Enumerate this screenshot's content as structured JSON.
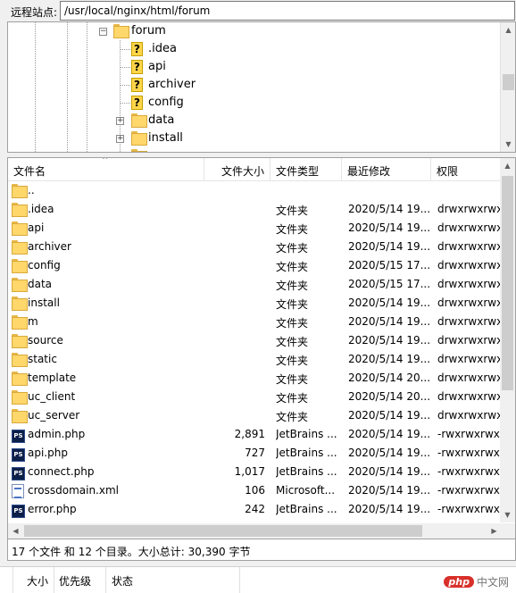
{
  "remote_site": {
    "label": "远程站点:",
    "path": "/usr/local/nginx/html/forum"
  },
  "tree": {
    "current": "forum",
    "children": [
      {
        "label": ".idea",
        "unknown": true
      },
      {
        "label": "api",
        "unknown": true
      },
      {
        "label": "archiver",
        "unknown": true
      },
      {
        "label": "config",
        "unknown": true
      },
      {
        "label": "data",
        "expandable": true
      },
      {
        "label": "install",
        "expandable": true
      }
    ]
  },
  "list": {
    "columns": [
      "文件名",
      "文件大小",
      "文件类型",
      "最近修改",
      "权限"
    ],
    "rows": [
      {
        "icon": "folder",
        "name": "..",
        "size": "",
        "type": "",
        "modified": "",
        "perms": ""
      },
      {
        "icon": "folder",
        "name": ".idea",
        "size": "",
        "type": "文件夹",
        "modified": "2020/5/14 19...",
        "perms": "drwxrwxrwx"
      },
      {
        "icon": "folder",
        "name": "api",
        "size": "",
        "type": "文件夹",
        "modified": "2020/5/14 19...",
        "perms": "drwxrwxrwx"
      },
      {
        "icon": "folder",
        "name": "archiver",
        "size": "",
        "type": "文件夹",
        "modified": "2020/5/14 19...",
        "perms": "drwxrwxrwx"
      },
      {
        "icon": "folder",
        "name": "config",
        "size": "",
        "type": "文件夹",
        "modified": "2020/5/15 17...",
        "perms": "drwxrwxrwx"
      },
      {
        "icon": "folder",
        "name": "data",
        "size": "",
        "type": "文件夹",
        "modified": "2020/5/15 17...",
        "perms": "drwxrwxrwx"
      },
      {
        "icon": "folder",
        "name": "install",
        "size": "",
        "type": "文件夹",
        "modified": "2020/5/14 19...",
        "perms": "drwxrwxrwx"
      },
      {
        "icon": "folder",
        "name": "m",
        "size": "",
        "type": "文件夹",
        "modified": "2020/5/14 19...",
        "perms": "drwxrwxrwx"
      },
      {
        "icon": "folder",
        "name": "source",
        "size": "",
        "type": "文件夹",
        "modified": "2020/5/14 19...",
        "perms": "drwxrwxrwx"
      },
      {
        "icon": "folder",
        "name": "static",
        "size": "",
        "type": "文件夹",
        "modified": "2020/5/14 19...",
        "perms": "drwxrwxrwx"
      },
      {
        "icon": "folder",
        "name": "template",
        "size": "",
        "type": "文件夹",
        "modified": "2020/5/14 20...",
        "perms": "drwxrwxrwx"
      },
      {
        "icon": "folder",
        "name": "uc_client",
        "size": "",
        "type": "文件夹",
        "modified": "2020/5/14 20...",
        "perms": "drwxrwxrwx"
      },
      {
        "icon": "folder",
        "name": "uc_server",
        "size": "",
        "type": "文件夹",
        "modified": "2020/5/14 19...",
        "perms": "drwxrwxrwx"
      },
      {
        "icon": "ps",
        "name": "admin.php",
        "size": "2,891",
        "type": "JetBrains ...",
        "modified": "2020/5/14 19...",
        "perms": "-rwxrwxrwx"
      },
      {
        "icon": "ps",
        "name": "api.php",
        "size": "727",
        "type": "JetBrains ...",
        "modified": "2020/5/14 19...",
        "perms": "-rwxrwxrwx"
      },
      {
        "icon": "ps",
        "name": "connect.php",
        "size": "1,017",
        "type": "JetBrains ...",
        "modified": "2020/5/14 19...",
        "perms": "-rwxrwxrwx"
      },
      {
        "icon": "xml",
        "name": "crossdomain.xml",
        "size": "106",
        "type": "Microsoft...",
        "modified": "2020/5/14 19...",
        "perms": "-rwxrwxrwx"
      },
      {
        "icon": "ps",
        "name": "error.php",
        "size": "242",
        "type": "JetBrains ...",
        "modified": "2020/5/14 19...",
        "perms": "-rwxrwxrwx"
      }
    ]
  },
  "status_text": "17 个文件 和 12 个目录。大小总计: 30,390 字节",
  "queue_columns": [
    "大小",
    "优先级",
    "状态"
  ],
  "ps_icon_text": "PS",
  "watermark": {
    "badge": "php",
    "text": "中文网"
  }
}
